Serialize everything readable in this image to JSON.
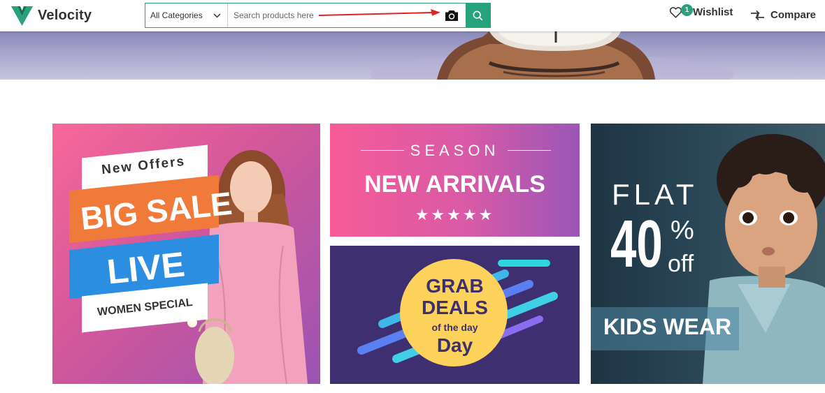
{
  "brand": {
    "name": "Velocity"
  },
  "search": {
    "category": "All Categories",
    "placeholder": "Search products here"
  },
  "header": {
    "wishlist_label": "Wishlist",
    "wishlist_count": "1",
    "compare_label": "Compare"
  },
  "colors": {
    "accent": "#26a37c",
    "annotation_arrow": "#e02424"
  },
  "icons": [
    "velocity-logo-icon",
    "chevron-down-icon",
    "camera-icon",
    "search-icon",
    "heart-icon",
    "compare-arrows-icon"
  ],
  "banners": {
    "sale": {
      "line1": "New Offers",
      "line2": "BIG SALE",
      "line3": "LIVE",
      "line4": "WOMEN SPECIAL"
    },
    "arrivals": {
      "line1": "SEASON",
      "line2": "NEW ARRIVALS",
      "stars": "★★★★★"
    },
    "deals": {
      "line1": "GRAB",
      "line2": "DEALS",
      "line3": "of the day",
      "line4": "Day"
    },
    "kids": {
      "line1": "FLAT",
      "line2": "40",
      "line3": "%",
      "line4": "off",
      "line5": "KIDS WEAR"
    }
  }
}
